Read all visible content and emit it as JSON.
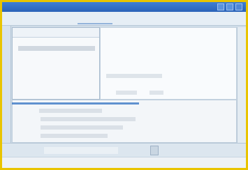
{
  "window": {
    "title": ""
  },
  "toolbar": {
    "items": [
      "",
      "",
      ""
    ]
  },
  "left_panel": {
    "header": "",
    "selected_item": ""
  },
  "right_pane": {
    "label_1": "",
    "label_2": "",
    "value_2": ""
  },
  "lower_list": {
    "items": [
      "",
      "",
      "",
      ""
    ]
  },
  "bottom_bar": {
    "path_value": ""
  },
  "status_bar": {
    "left_text": "",
    "right_text": ""
  },
  "colors": {
    "outer_border": "#e9c400",
    "title_bar": "#2a62b8",
    "accent": "#2f6fc0",
    "window_bg": "#cfdce8"
  },
  "icons": [
    "minimize-icon",
    "maximize-icon",
    "close-icon",
    "go-icon"
  ]
}
